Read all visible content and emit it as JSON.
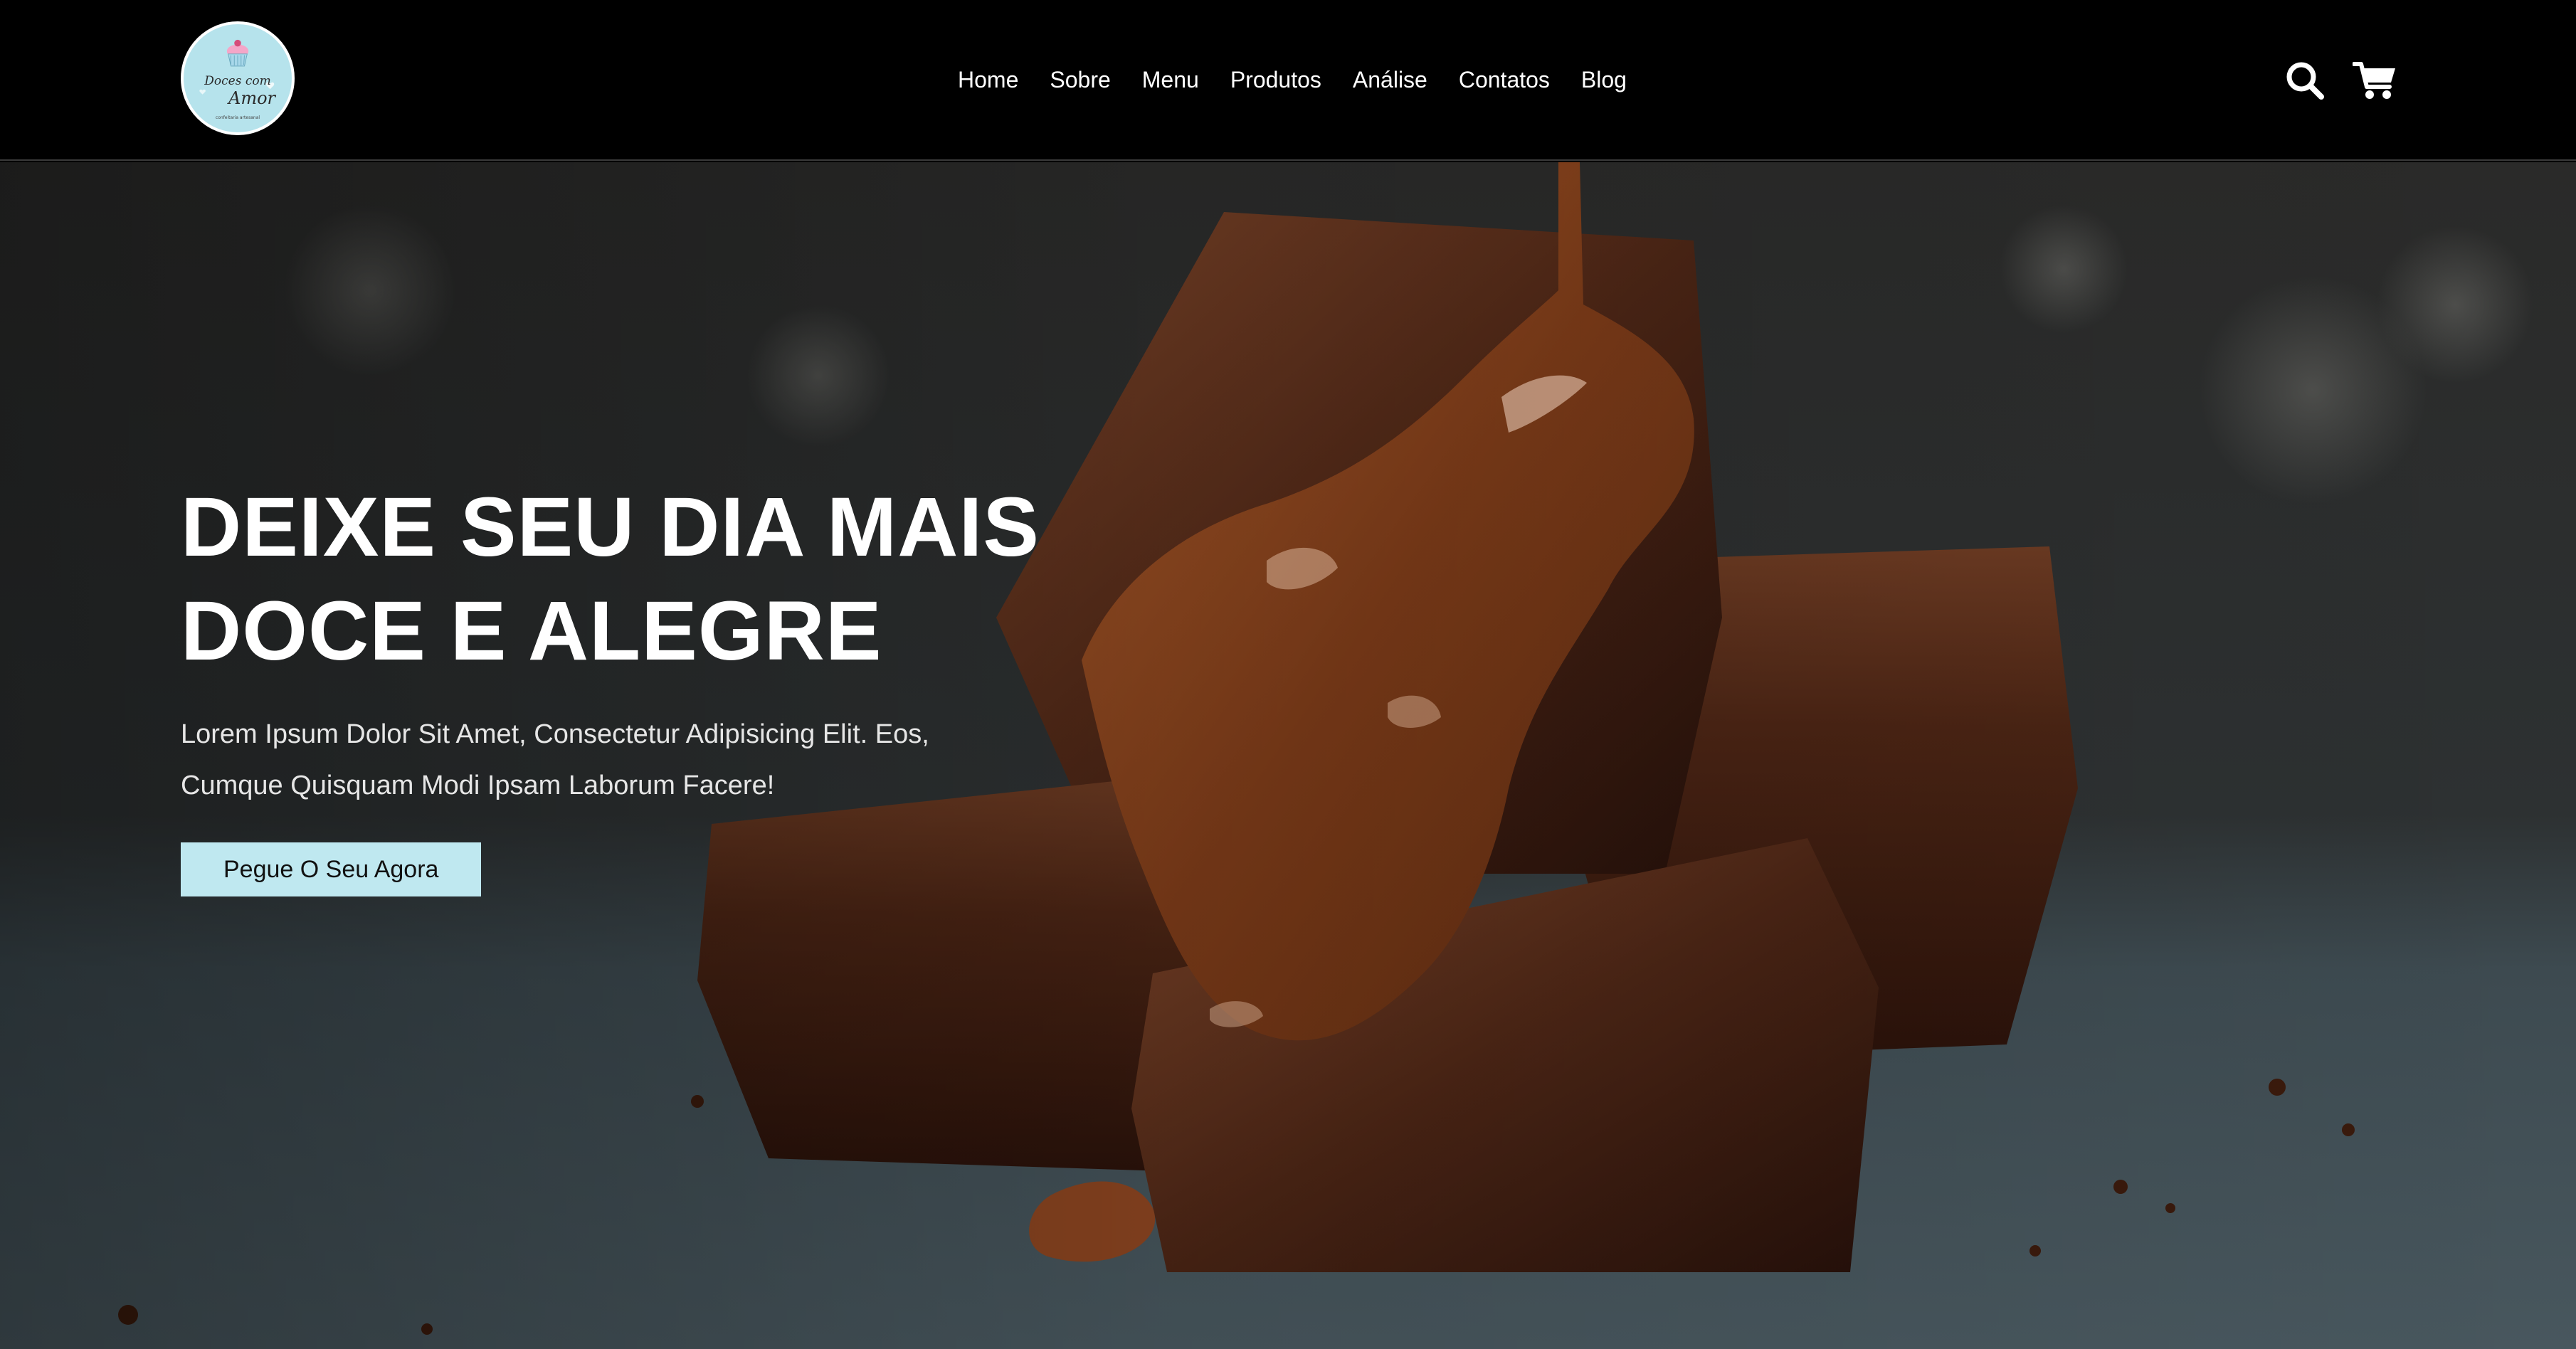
{
  "brand": {
    "logo_line1": "Doces com",
    "logo_line2": "Amor",
    "logo_tagline": "confeitaria artesanal"
  },
  "nav": {
    "items": [
      {
        "label": "Home"
      },
      {
        "label": "Sobre"
      },
      {
        "label": "Menu"
      },
      {
        "label": "Produtos"
      },
      {
        "label": "Análise"
      },
      {
        "label": "Contatos"
      },
      {
        "label": "Blog"
      }
    ]
  },
  "icons": {
    "search": "search-icon",
    "cart": "shopping-cart-icon"
  },
  "hero": {
    "title": "DEIXE SEU DIA MAIS DOCE E ALEGRE",
    "subtitle": "Lorem Ipsum Dolor Sit Amet, Consectetur Adipisicing Elit. Eos, Cumque Quisquam Modi Ipsam Laborum Facere!",
    "cta_label": "Pegue O Seu Agora",
    "image": "brownies with chocolate sauce"
  },
  "colors": {
    "header_bg": "#000000",
    "accent": "#bfe8f0",
    "logo_bg": "#b6e3ec",
    "text_light": "#ffffff"
  }
}
